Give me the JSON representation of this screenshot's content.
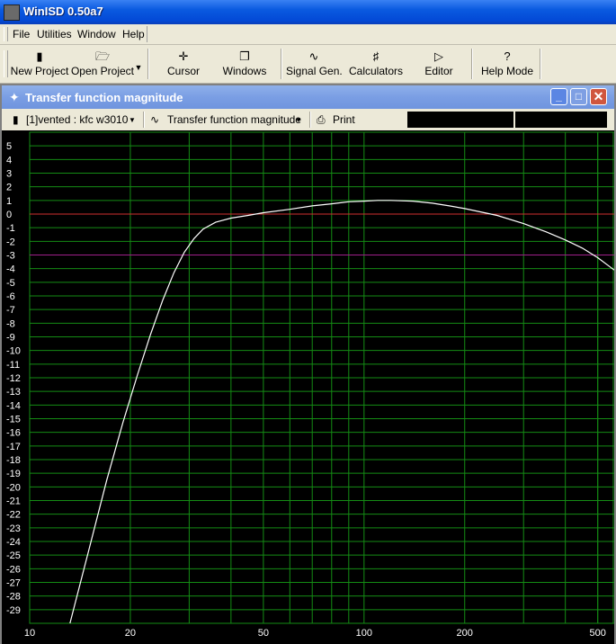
{
  "app": {
    "title": "WinISD 0.50a7"
  },
  "menu": {
    "items": [
      "File",
      "Utilities",
      "Window",
      "Help"
    ]
  },
  "toolbar": {
    "buttons": [
      {
        "label": "New Project",
        "icon": "new-project-icon"
      },
      {
        "label": "Open Project",
        "icon": "open-folder-icon"
      },
      {
        "label": "Cursor",
        "icon": "crosshair-icon"
      },
      {
        "label": "Windows",
        "icon": "windows-icon"
      },
      {
        "label": "Signal Gen.",
        "icon": "sine-wave-icon"
      },
      {
        "label": "Calculators",
        "icon": "calculator-icon"
      },
      {
        "label": "Editor",
        "icon": "speaker-editor-icon"
      },
      {
        "label": "Help Mode",
        "icon": "question-icon"
      }
    ]
  },
  "child_window": {
    "title": "Transfer function magnitude",
    "project_select": "[1]vented : kfc w3010",
    "graph_select": "Transfer function magnitude",
    "print_label": "Print"
  },
  "chart_data": {
    "type": "line",
    "xlabel": "",
    "ylabel": "",
    "x_scale": "log",
    "xlim": [
      10,
      560
    ],
    "ylim": [
      -30,
      6
    ],
    "x_tick_labels": [
      "10",
      "20",
      "50",
      "100",
      "200",
      "500"
    ],
    "x_ticks": [
      10,
      20,
      50,
      100,
      200,
      500
    ],
    "y_tick_labels": [
      "5",
      "4",
      "3",
      "2",
      "1",
      "0",
      "-1",
      "-2",
      "-3",
      "-4",
      "-5",
      "-6",
      "-7",
      "-8",
      "-9",
      "-10",
      "-11",
      "-12",
      "-13",
      "-14",
      "-15",
      "-16",
      "-17",
      "-18",
      "-19",
      "-20",
      "-21",
      "-22",
      "-23",
      "-24",
      "-25",
      "-26",
      "-27",
      "-28",
      "-29"
    ],
    "grid": true,
    "reference_lines": [
      {
        "y": 0,
        "color": "#d03030"
      },
      {
        "y": -3,
        "color": "#a0208a"
      }
    ],
    "series": [
      {
        "color": "#ffffff",
        "x": [
          13.2,
          15,
          17,
          19,
          21,
          23,
          25,
          27,
          29,
          31,
          33,
          36,
          40,
          45,
          50,
          60,
          70,
          80,
          90,
          100,
          110,
          120,
          140,
          160,
          180,
          200,
          250,
          300,
          350,
          400,
          450,
          500,
          560
        ],
        "y": [
          -30,
          -24.7,
          -19.5,
          -15.3,
          -11.8,
          -8.8,
          -6.3,
          -4.3,
          -2.8,
          -1.8,
          -1.1,
          -0.6,
          -0.3,
          -0.1,
          0.1,
          0.35,
          0.6,
          0.75,
          0.9,
          0.95,
          1.0,
          1.0,
          0.95,
          0.8,
          0.6,
          0.4,
          -0.1,
          -0.7,
          -1.3,
          -1.9,
          -2.5,
          -3.2,
          -4.1
        ]
      }
    ]
  },
  "colors": {
    "plot_background": "#000000",
    "grid": "#148c14",
    "axis_labels": "#ffffff",
    "titlebar": "#0a5ae0",
    "child_titlebar": "#7a9ee4"
  }
}
